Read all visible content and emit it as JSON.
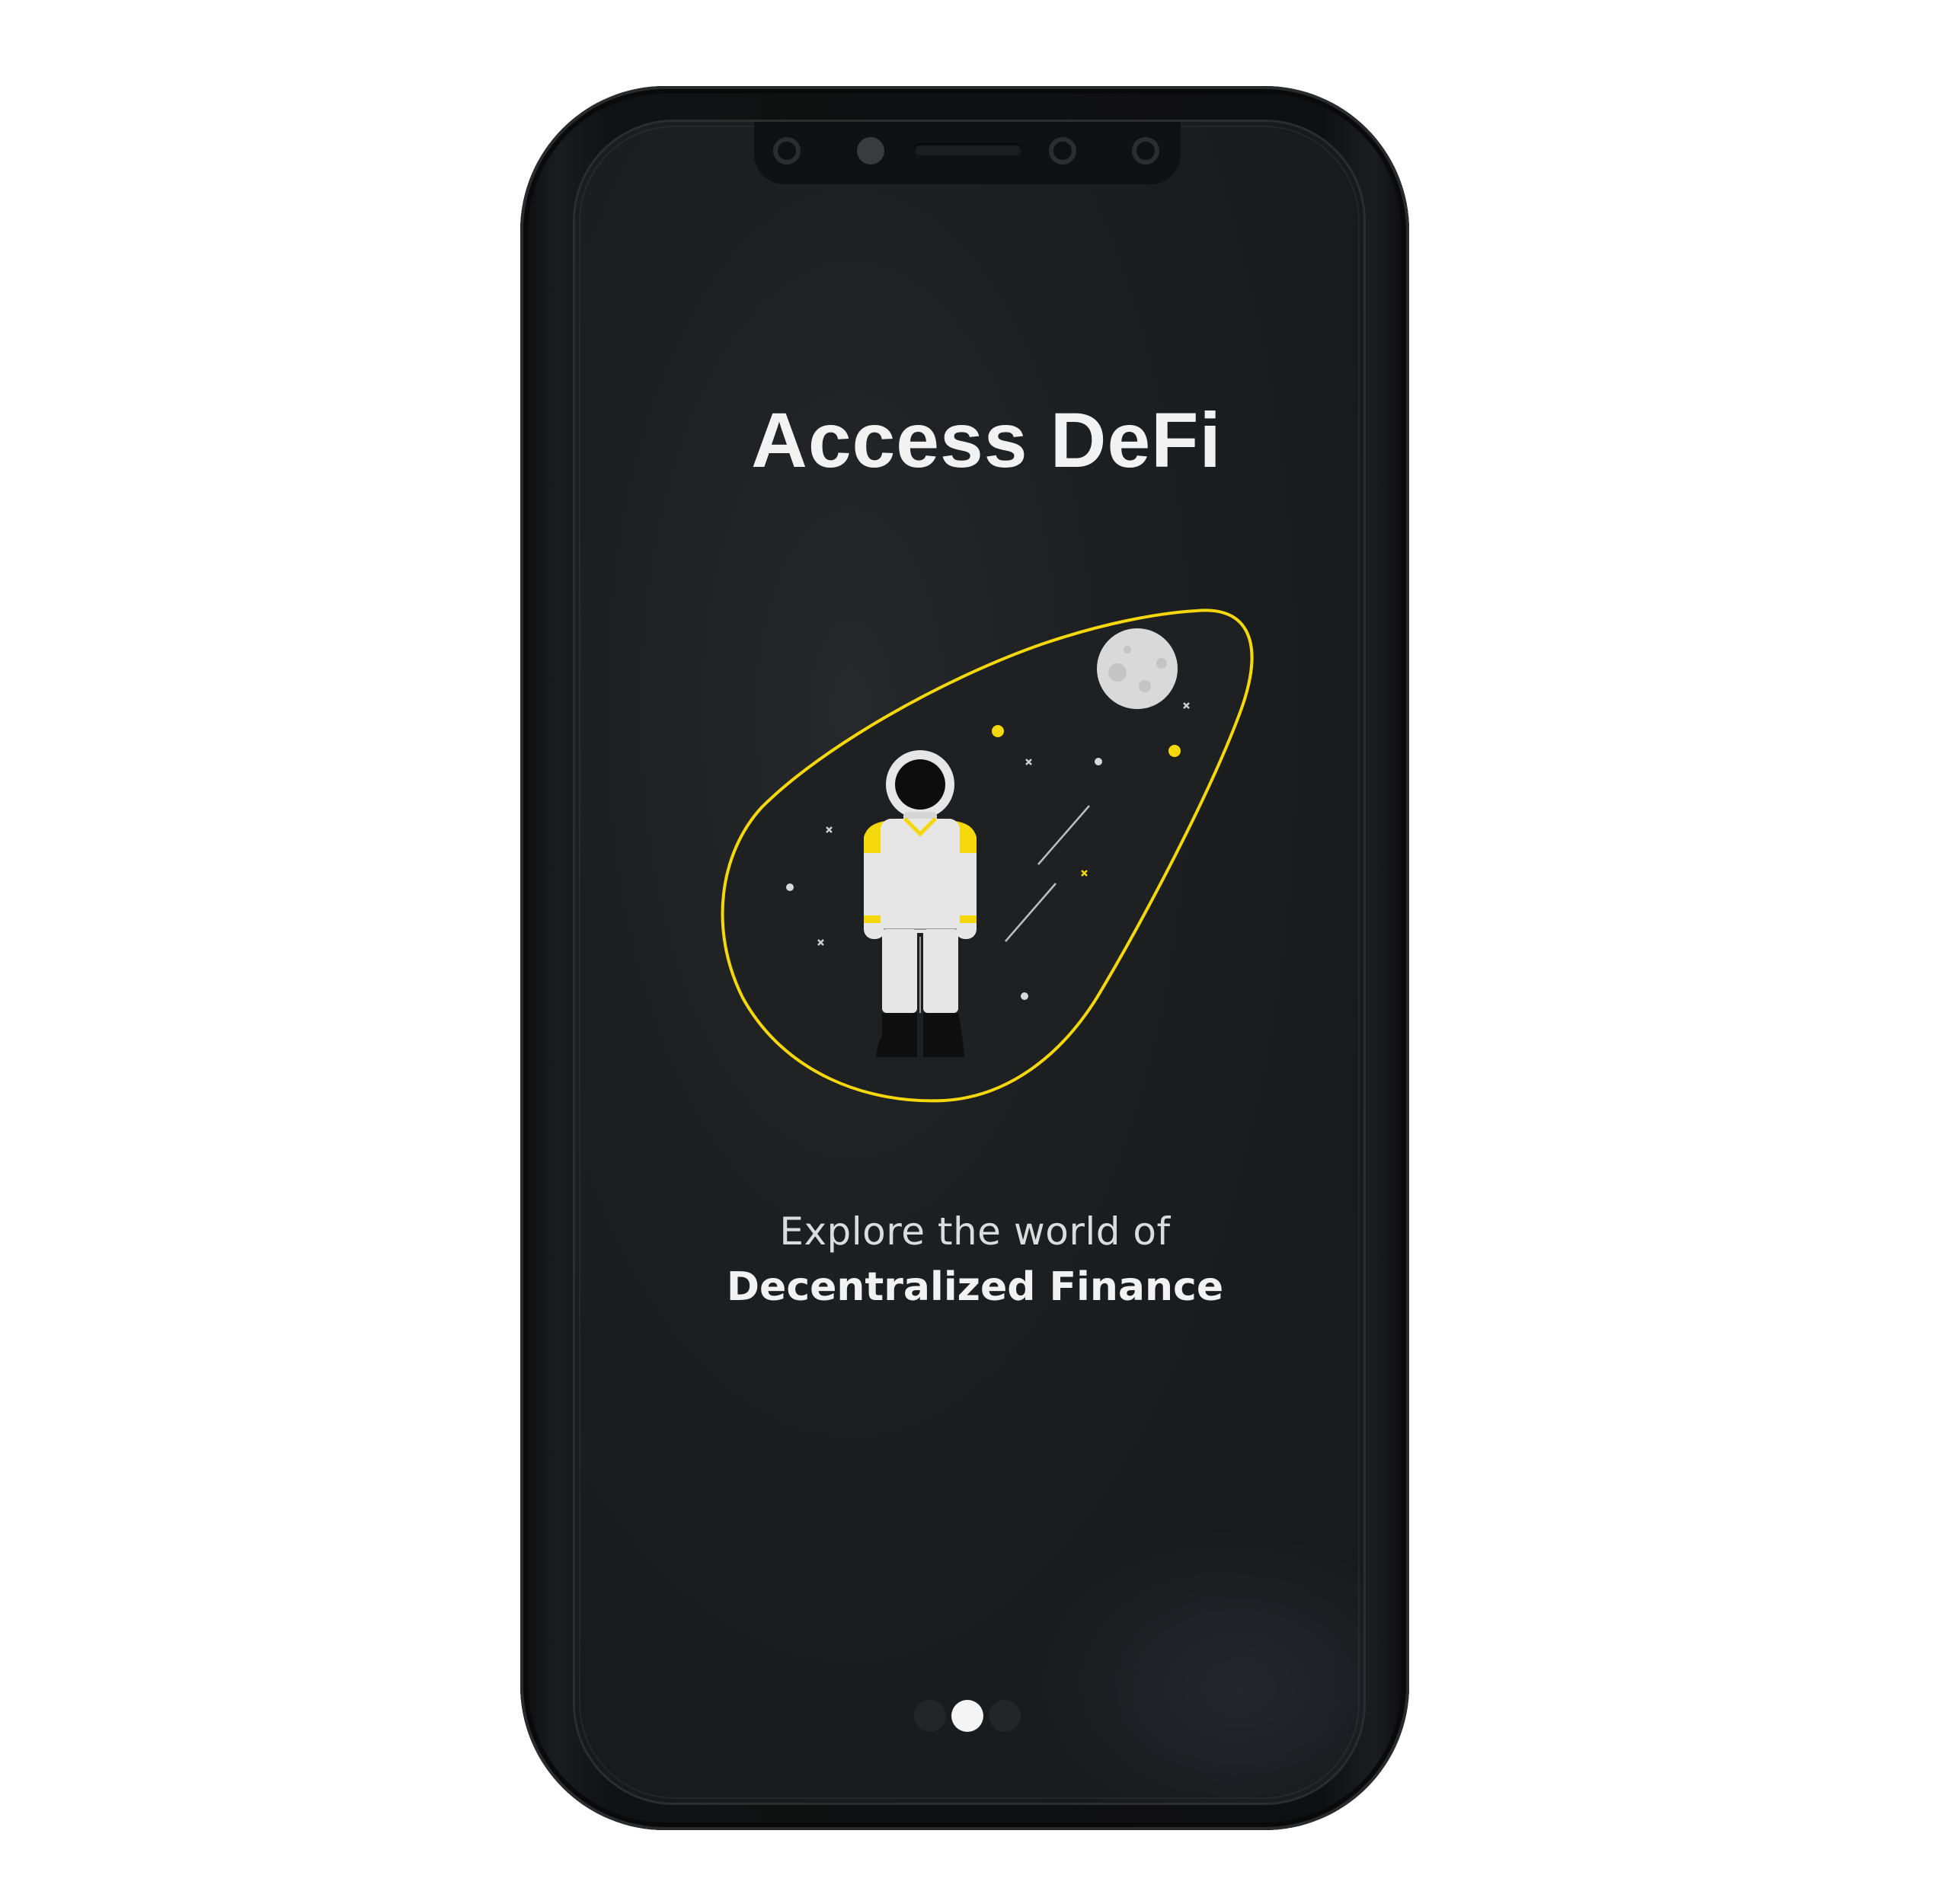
{
  "screen": {
    "title": "Access DeFi",
    "subtitle_line1": "Explore the world of",
    "subtitle_line2": "Decentralized Finance"
  },
  "illustration": {
    "subject": "astronaut-in-space",
    "accent_color": "#f5d80b"
  },
  "pager": {
    "page_count": 3,
    "active_index": 1
  },
  "colors": {
    "screen_background": "#1b1d1f",
    "text_primary": "#f2f2f2",
    "accent": "#f5d80b"
  }
}
